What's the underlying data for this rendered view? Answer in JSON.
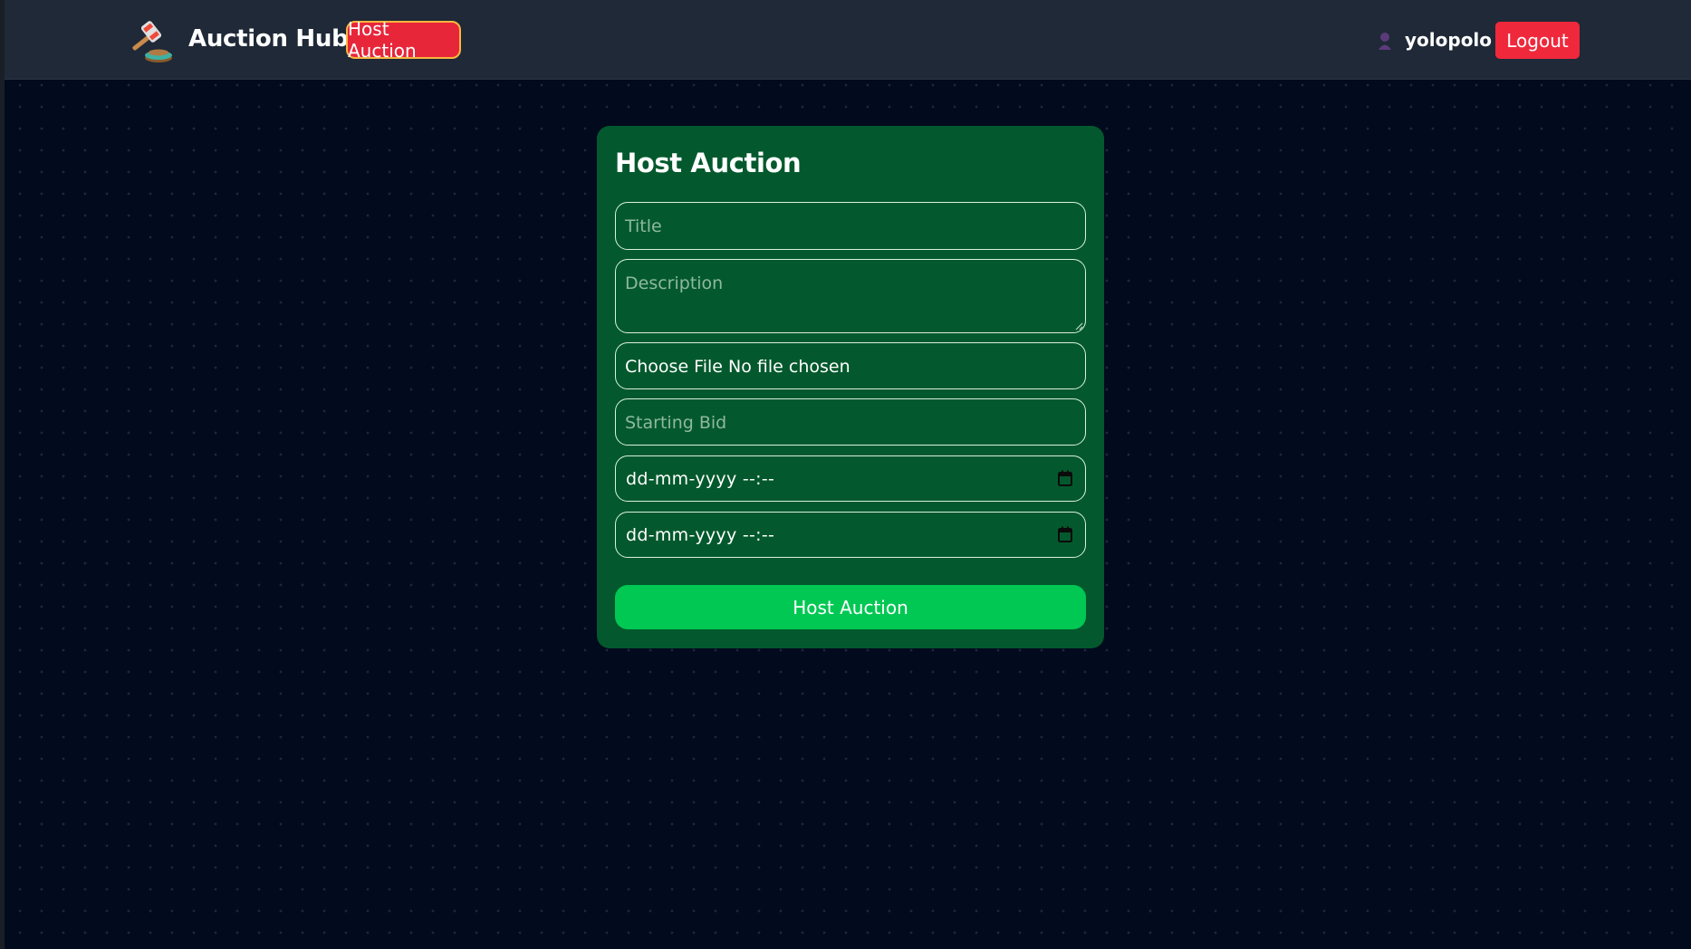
{
  "header": {
    "brand": "Auction Hub",
    "logo_icon": "gavel-icon",
    "host_auction_label": "Host Auction",
    "user_icon": "user-icon",
    "username": "yolopolo",
    "logout_label": "Logout"
  },
  "form": {
    "title": "Host Auction",
    "title_placeholder": "Title",
    "description_placeholder": "Description",
    "file_input_text": "Choose File No file chosen",
    "starting_bid_placeholder": "Starting Bid",
    "start_datetime_value": "dd-mm-yyyy --:--",
    "end_datetime_value": "dd-mm-yyyy --:--",
    "calendar_icon": "calendar-icon",
    "submit_label": "Host Auction"
  },
  "colors": {
    "page_background": "#020a1e",
    "navbar_background": "#1f2937",
    "accent_red": "#e8263a",
    "card_background": "#03592d",
    "submit_green": "#00c853"
  }
}
